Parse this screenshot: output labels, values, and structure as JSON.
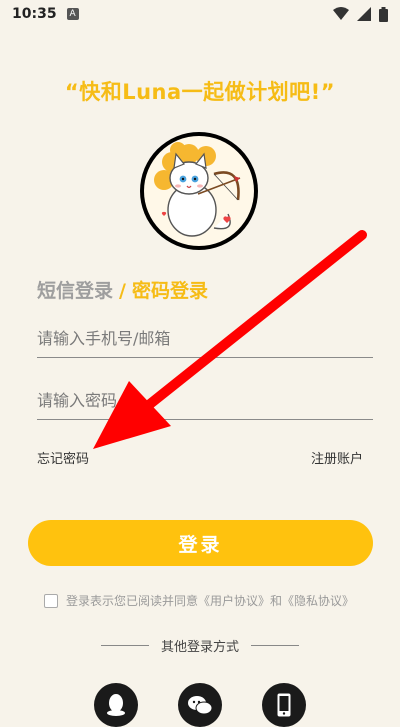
{
  "status_bar": {
    "time": "10:35",
    "badge": "A"
  },
  "header": {
    "slogan": "“快和Luna一起做计划吧!”"
  },
  "tabs": {
    "sms": "短信登录",
    "separator": "/",
    "password": "密码登录"
  },
  "form": {
    "account_placeholder": "请输入手机号/邮箱",
    "password_placeholder": "请输入密码",
    "forgot_label": "忘记密码",
    "register_label": "注册账户",
    "login_label": "登录"
  },
  "agreement": {
    "prefix": "登录表示您已阅读并同意",
    "user_agreement": "《用户协议》",
    "and": "和",
    "privacy_agreement": "《隐私协议》"
  },
  "other_login": {
    "label": "其他登录方式"
  },
  "colors": {
    "accent": "#FFC20E",
    "background": "#F7F3EA",
    "annotation_arrow": "#FF0000"
  },
  "icons": [
    "wifi-icon",
    "signal-icon",
    "battery-icon",
    "qq-icon",
    "wechat-icon",
    "phone-icon"
  ]
}
